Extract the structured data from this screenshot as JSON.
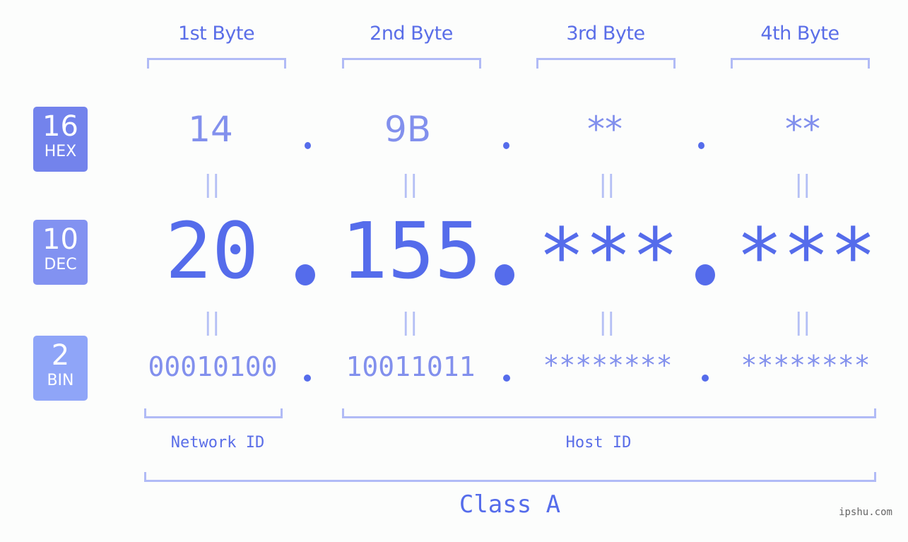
{
  "bytes": [
    {
      "header": "1st Byte",
      "hex": "14",
      "dec": "20",
      "bin": "00010100"
    },
    {
      "header": "2nd Byte",
      "hex": "9B",
      "dec": "155",
      "bin": "10011011"
    },
    {
      "header": "3rd Byte",
      "hex": "**",
      "dec": "***",
      "bin": "********"
    },
    {
      "header": "4th Byte",
      "hex": "**",
      "dec": "***",
      "bin": "********"
    }
  ],
  "badges": {
    "hex": {
      "num": "16",
      "label": "HEX",
      "color": "#7383ec"
    },
    "dec": {
      "num": "10",
      "label": "DEC",
      "color": "#8292f1"
    },
    "bin": {
      "num": "2",
      "label": "BIN",
      "color": "#8fa5f8"
    }
  },
  "equals_symbol": "||",
  "network_label": "Network ID",
  "host_label": "Host ID",
  "class_label": "Class A",
  "watermark": "ipshu.com",
  "colors": {
    "primary": "#556ceb",
    "secondary": "#8290ed",
    "bracket": "#b1bbf6",
    "background": "#fcfdfc"
  }
}
